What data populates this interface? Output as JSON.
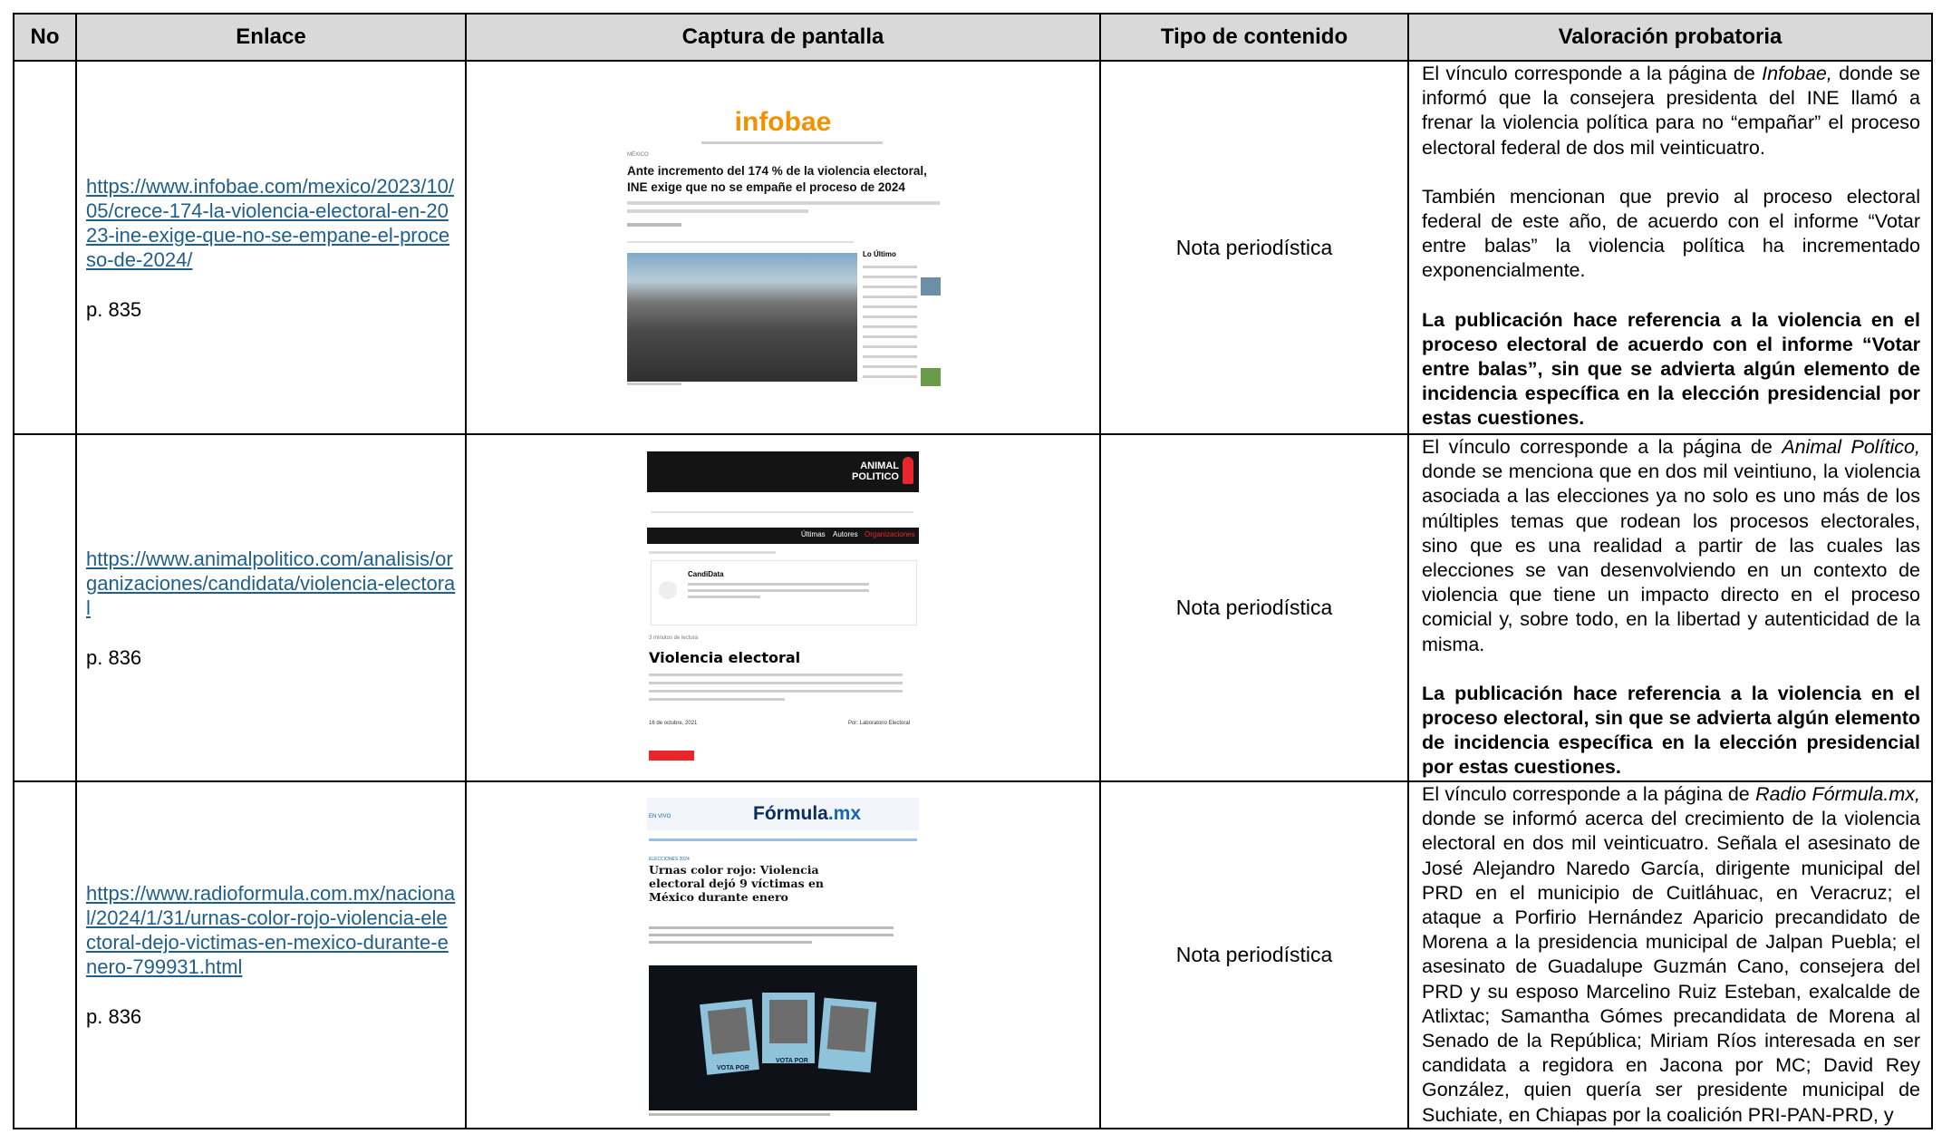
{
  "headers": [
    "No",
    "Enlace",
    "Captura de pantalla",
    "Tipo de contenido",
    "Valoración probatoria"
  ],
  "rows": [
    {
      "no": "",
      "link": "https://www.infobae.com/mexico/2023/10/05/crece-174-la-violencia-electoral-en-2023-ine-exige-que-no-se-empane-el-proceso-de-2024/",
      "page": "p. 835",
      "type": "Nota periodística",
      "shot": {
        "logo": "infobae",
        "headline": "Ante incremento del 174 % de la violencia electoral, INE exige que no se empañe el proceso de 2024",
        "section": "MÉXICO",
        "sidebar_title": "Lo Último"
      },
      "val_p1_a": "El vínculo corresponde a la página de ",
      "val_p1_em": "Infobae,",
      "val_p1_b": " donde se informó que la consejera presidenta del INE llamó a frenar la violencia política para no “empañar” el proceso electoral federal de dos mil veinticuatro.",
      "val_p2": "También mencionan que previo al proceso electoral federal de este año, de acuerdo con el informe “Votar entre balas” la violencia política ha incrementado exponencialmente.",
      "val_bold": "La publicación hace referencia a la violencia en el proceso electoral de acuerdo con el informe “Votar entre balas”, sin que se advierta algún elemento de incidencia específica en la elección presidencial por estas cuestiones."
    },
    {
      "no": "",
      "link": "https://www.animalpolitico.com/analisis/organizaciones/candidata/violencia-electoral",
      "page": "p. 836",
      "type": "Nota periodística",
      "shot": {
        "logo_line1": "ANIMAL",
        "logo_line2": "POLITICO",
        "nav": [
          "Últimas",
          "Autores",
          "Organizaciones"
        ],
        "card_title": "CandiData",
        "read_time": "3 minutos de lectura",
        "title": "Violencia electoral",
        "date": "16 de octubre, 2021",
        "byline": "Por: Laboratorio Electoral"
      },
      "val_p1_a": "El vínculo corresponde a la página de ",
      "val_p1_em": "Animal Político,",
      "val_p1_b": " donde se menciona que en dos mil veintiuno, la violencia asociada a las elecciones ya no solo es uno más de los múltiples temas que rodean los procesos electorales, sino que es una realidad a partir de las cuales las elecciones se van desenvolviendo en un contexto de violencia que tiene un impacto directo en el proceso comicial y, sobre todo, en la libertad y autenticidad de la misma.",
      "val_bold": "La publicación hace referencia a la violencia en el proceso electoral, sin que se advierta algún elemento de incidencia específica en la elección presidencial por estas cuestiones."
    },
    {
      "no": "",
      "link": "https://www.radioformula.com.mx/nacional/2024/1/31/urnas-color-rojo-violencia-electoral-dejo-victimas-en-mexico-durante-enero-799931.html",
      "page": "p. 836",
      "type": "Nota periodística",
      "shot": {
        "logo_a": "Fórmula",
        "logo_b": ".mx",
        "live": "EN VIVO",
        "tag": "ELECCIONES 2024",
        "headline": "Urnas color rojo: Violencia electoral dejó 9 víctimas en México durante enero",
        "vote": "VOTA POR"
      },
      "val_p1_a": "El vínculo corresponde a la página de ",
      "val_p1_em": "Radio Fórmula.mx,",
      "val_p1_b": " donde se informó acerca del crecimiento de la violencia electoral en dos mil veinticuatro. Señala el asesinato de José Alejandro Naredo García, dirigente municipal del PRD en el municipio de Cuitláhuac, en Veracruz; el ataque a Porfirio Hernández Aparicio precandidato de Morena a la presidencia municipal de Jalpan Puebla; el asesinato de Guadalupe Guzmán Cano, consejera del PRD y su esposo Marcelino Ruiz Esteban, exalcalde de Atlixtac; Samantha Gómes precandidata de Morena al Senado de la República; Miriam Ríos interesada en ser candidata a regidora en Jacona por MC; David Rey González, quien quería ser presidente municipal de Suchiate, en Chiapas por la coalición PRI-PAN-PRD, y"
    }
  ]
}
